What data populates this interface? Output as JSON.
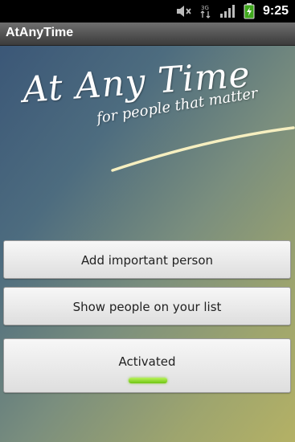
{
  "status_bar": {
    "time": "9:25",
    "icons": [
      "mute-icon",
      "data-arrows-icon",
      "signal-icon",
      "battery-charging-icon"
    ]
  },
  "app": {
    "title": "AtAnyTime"
  },
  "logo": {
    "title": "At Any Time",
    "subtitle": "for people that matter"
  },
  "buttons": {
    "add_person": "Add important person",
    "show_people": "Show people on your list",
    "toggle": "Activated",
    "toggle_state": true
  },
  "colors": {
    "indicator_on": "#7fd21a",
    "background_top_left": "#3b5777",
    "background_bottom_right": "#b4b165"
  }
}
